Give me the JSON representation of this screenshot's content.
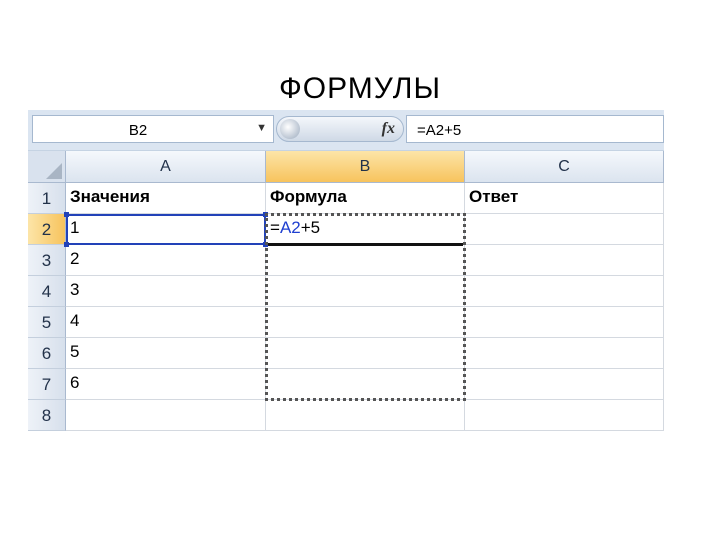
{
  "slide": {
    "title": "ФОРМУЛЫ"
  },
  "formula_bar": {
    "name_box": "B2",
    "name_box_arrow": "▼",
    "fx_label": "fx",
    "formula": "=A2+5"
  },
  "columns": [
    "A",
    "B",
    "C"
  ],
  "active_column": "B",
  "rows": [
    {
      "num": "1",
      "cells": [
        "Значения",
        "Формула",
        "Ответ"
      ]
    },
    {
      "num": "2",
      "cells": [
        "1",
        "",
        ""
      ]
    },
    {
      "num": "3",
      "cells": [
        "2",
        "",
        ""
      ]
    },
    {
      "num": "4",
      "cells": [
        "3",
        "",
        ""
      ]
    },
    {
      "num": "5",
      "cells": [
        "4",
        "",
        ""
      ]
    },
    {
      "num": "6",
      "cells": [
        "5",
        "",
        ""
      ]
    },
    {
      "num": "7",
      "cells": [
        "6",
        "",
        ""
      ]
    },
    {
      "num": "8",
      "cells": [
        "",
        "",
        ""
      ]
    }
  ],
  "active_row": "2",
  "editing_cell": {
    "address": "B2",
    "prefix": "=",
    "reference": "A2",
    "suffix": "+5"
  }
}
